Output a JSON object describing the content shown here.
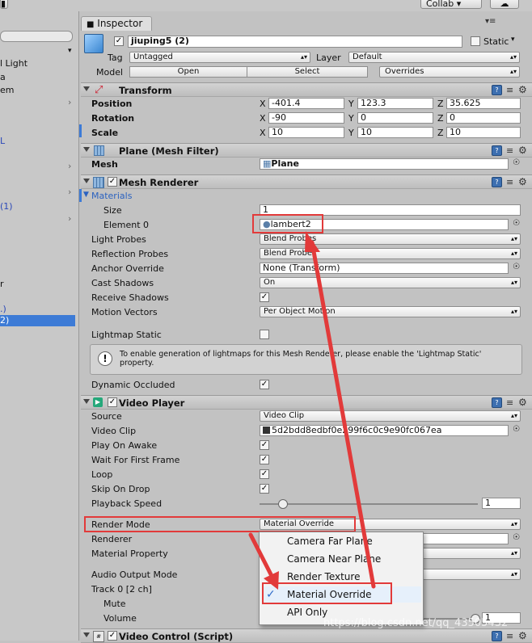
{
  "toolbar": {
    "collab_label": "Collab ▾",
    "cloud_icon": "cloud-icon"
  },
  "hierarchy": {
    "items": [
      "l Light",
      "a",
      "em",
      "L",
      "(1)",
      ".)",
      "2)",
      "r"
    ]
  },
  "inspector": {
    "tab_label": "Inspector",
    "object_name": "jiuping5 (2)",
    "static_label": "Static",
    "tag_label": "Tag",
    "tag_value": "Untagged",
    "layer_label": "Layer",
    "layer_value": "Default",
    "model_label": "Model",
    "model_buttons": [
      "Open",
      "Select",
      "Overrides"
    ]
  },
  "transform": {
    "title": "Transform",
    "position_label": "Position",
    "rotation_label": "Rotation",
    "scale_label": "Scale",
    "axes": [
      "X",
      "Y",
      "Z"
    ],
    "position": [
      "-401.4",
      "123.3",
      "35.625"
    ],
    "rotation": [
      "-90",
      "0",
      "0"
    ],
    "scale": [
      "10",
      "10",
      "10"
    ]
  },
  "mesh_filter": {
    "title": "Plane (Mesh Filter)",
    "mesh_label": "Mesh",
    "mesh_value": "Plane"
  },
  "mesh_renderer": {
    "title": "Mesh Renderer",
    "materials_label": "Materials",
    "size_label": "Size",
    "size_value": "1",
    "element0_label": "Element 0",
    "element0_value": "lambert2",
    "light_probes_label": "Light Probes",
    "light_probes_value": "Blend Probes",
    "reflection_probes_label": "Reflection Probes",
    "reflection_probes_value": "Blend Probes",
    "anchor_override_label": "Anchor Override",
    "anchor_override_value": "None (Transform)",
    "cast_shadows_label": "Cast Shadows",
    "cast_shadows_value": "On",
    "receive_shadows_label": "Receive Shadows",
    "motion_vectors_label": "Motion Vectors",
    "motion_vectors_value": "Per Object Motion",
    "lightmap_static_label": "Lightmap Static",
    "info_text": "To enable generation of lightmaps for this Mesh Renderer, please enable the 'Lightmap Static' property.",
    "dynamic_occluded_label": "Dynamic Occluded"
  },
  "video_player": {
    "title": "Video Player",
    "source_label": "Source",
    "source_value": "Video Clip",
    "video_clip_label": "Video Clip",
    "video_clip_value": "5d2bdd8edbf0e299f6c0c9e90fc067ea",
    "play_on_awake_label": "Play On Awake",
    "wait_first_frame_label": "Wait For First Frame",
    "loop_label": "Loop",
    "skip_on_drop_label": "Skip On Drop",
    "playback_speed_label": "Playback Speed",
    "playback_speed_value": "1",
    "render_mode_label": "Render Mode",
    "render_mode_value": "Material Override",
    "renderer_label": "Renderer",
    "material_property_label": "Material Property",
    "audio_output_label": "Audio Output Mode",
    "track0_label": "Track 0 [2 ch]",
    "mute_label": "Mute",
    "volume_label": "Volume",
    "volume_value": "1"
  },
  "render_mode_menu": {
    "options": [
      "Camera Far Plane",
      "Camera Near Plane",
      "Render Texture",
      "Material Override",
      "API Only"
    ],
    "selected": "Material Override",
    "check_glyph": "✓"
  },
  "video_control": {
    "title": "Video Control (Script)"
  },
  "watermark": "https://blog.csdn.net/qq_43505432",
  "colors": {
    "annotation_red": "#e23a3a",
    "selection_blue": "#3d7bd6"
  }
}
